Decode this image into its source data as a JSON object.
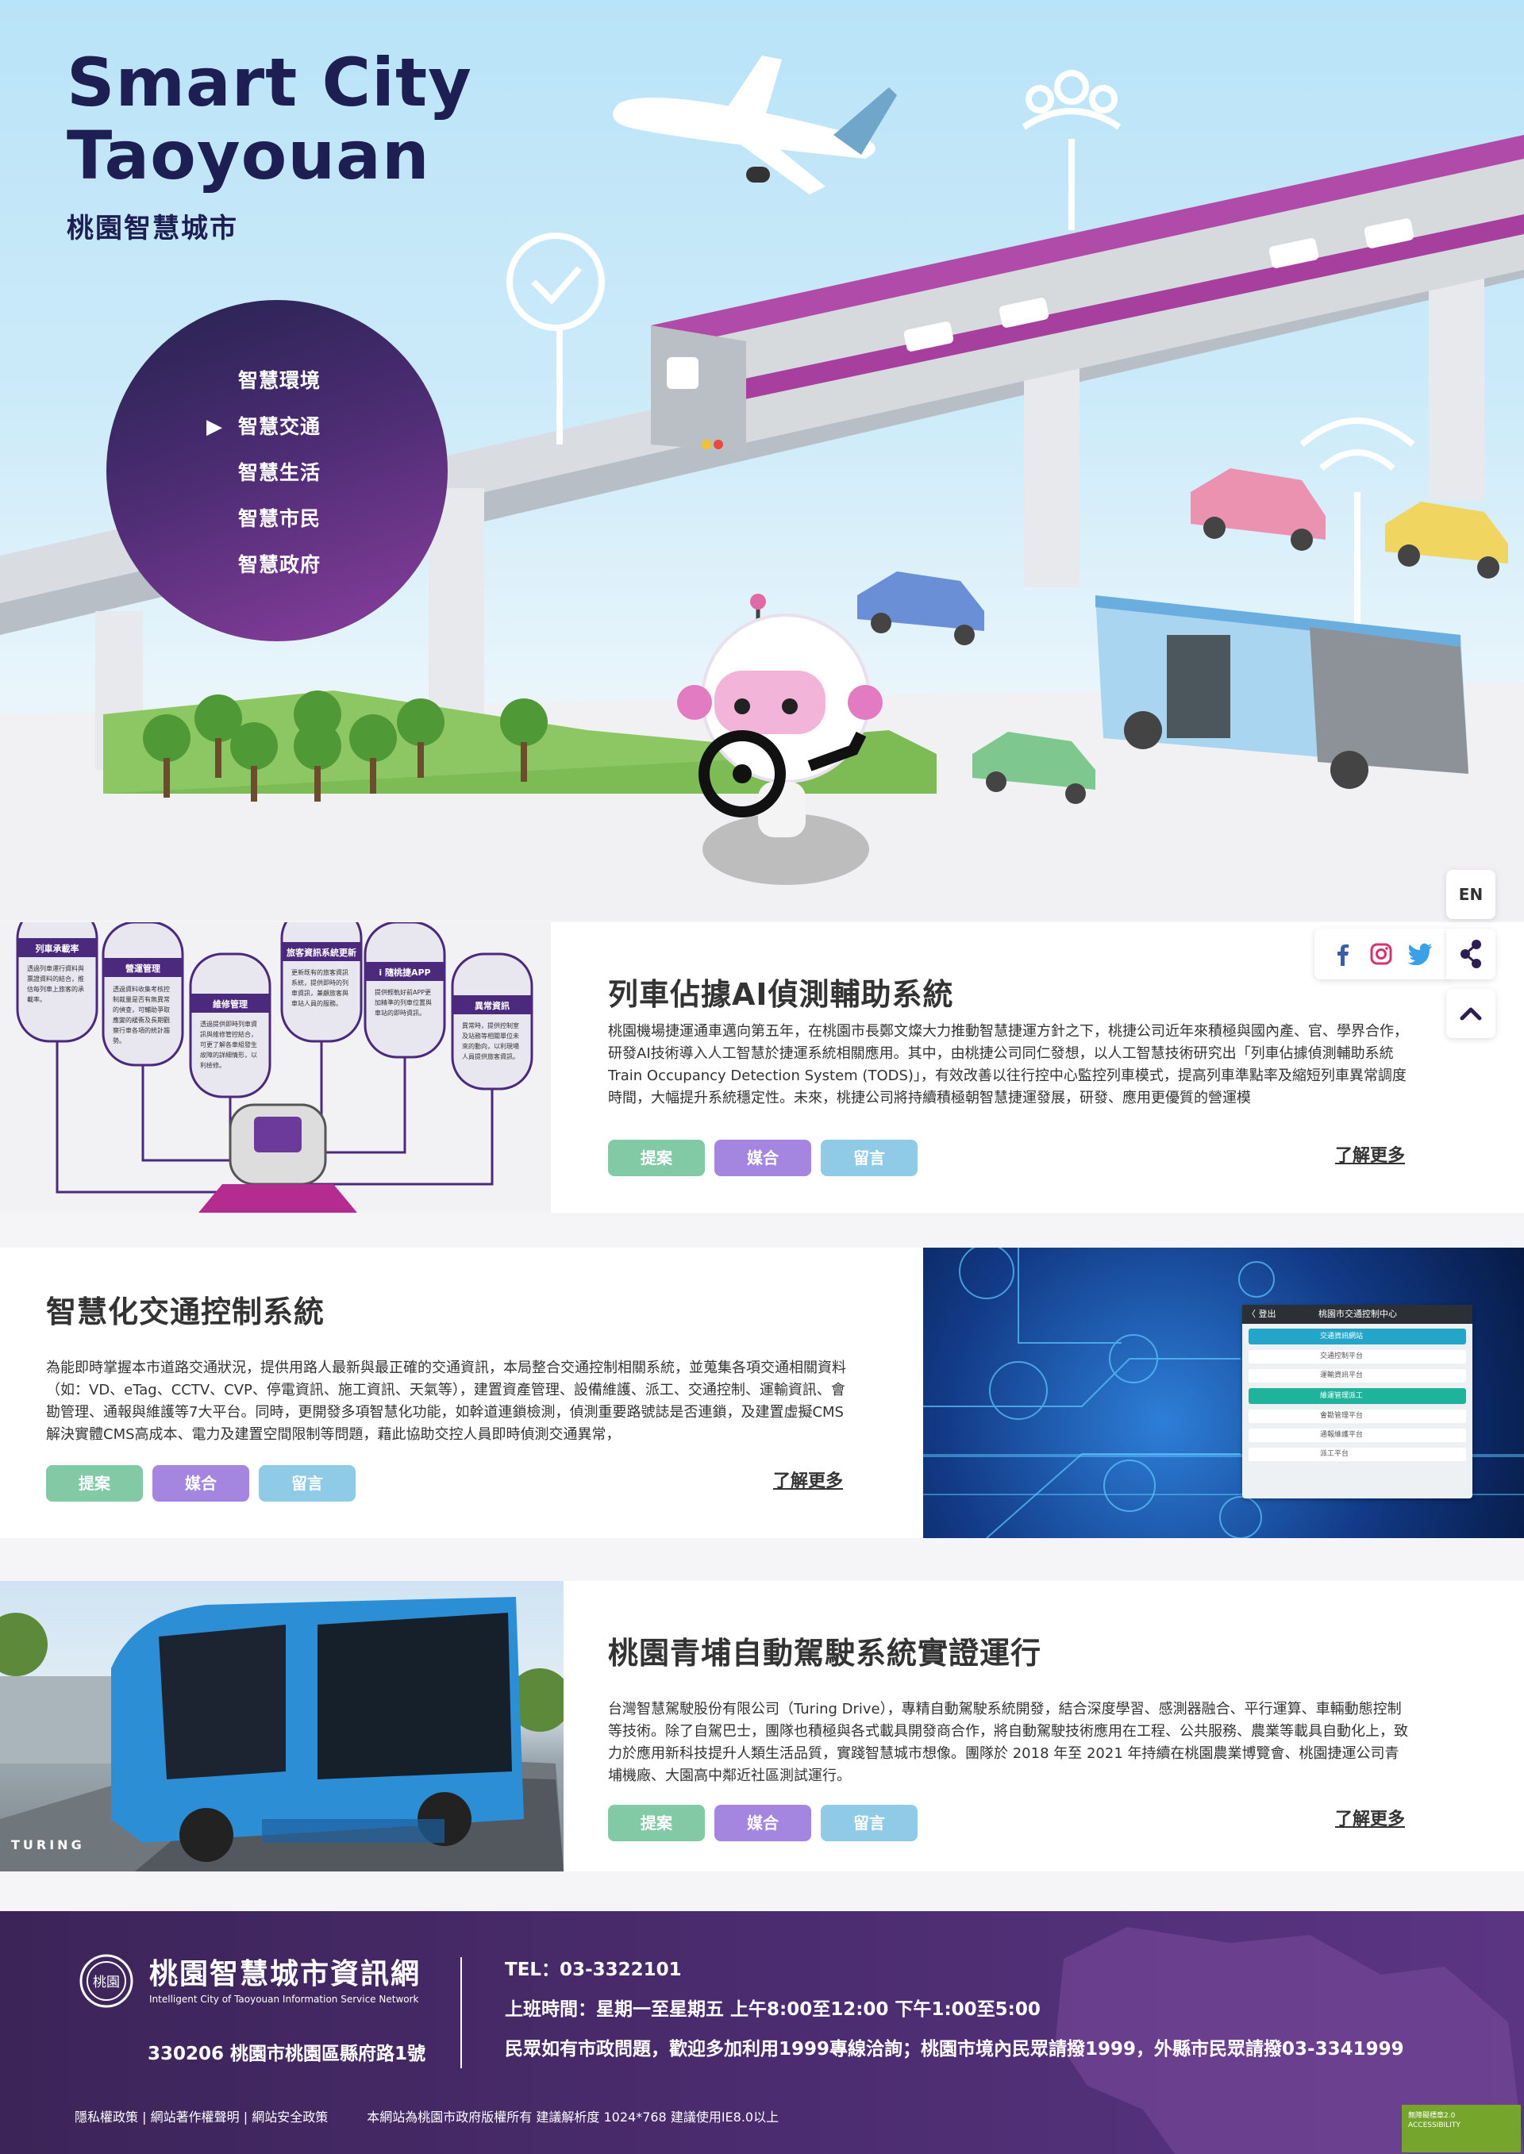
{
  "brand": {
    "title_line1": "Smart City",
    "title_line2": "Taoyouan",
    "subtitle": "桃園智慧城市"
  },
  "menu": {
    "items": [
      {
        "label": "智慧環境"
      },
      {
        "label": "智慧交通",
        "active": true
      },
      {
        "label": "智慧生活"
      },
      {
        "label": "智慧市民"
      },
      {
        "label": "智慧政府"
      }
    ]
  },
  "tools": {
    "lang_label": "EN",
    "social_icons": [
      "facebook-icon",
      "instagram-icon",
      "twitter-icon"
    ],
    "share_icon": "share-icon",
    "top_icon": "chevron-up-icon"
  },
  "buttons": {
    "propose": "提案",
    "match": "媒合",
    "comment": "留言",
    "more": "了解更多"
  },
  "colors": {
    "propose": "#82c9a5",
    "match": "#a486e0",
    "comment": "#8fcbe6",
    "purple": "#7d2f91",
    "navy": "#1d1e52"
  },
  "projects": [
    {
      "title": "列車佔據AI偵測輔助系統",
      "text": "桃園機場捷運通車邁向第五年，在桃園市長鄭文燦大力推動智慧捷運方針之下，桃捷公司近年來積極與國內產、官、學界合作，研發AI技術導入人工智慧於捷運系統相關應用。其中，由桃捷公司同仁發想，以人工智慧技術研究出「列車佔據偵測輔助系統Train Occupancy Detection System (TODS)」，有效改善以往行控中心監控列車模式，提高列車準點率及縮短列車異常調度時間，大幅提升系統穩定性。未來，桃捷公司將持續積極朝智慧捷運發展，研發、應用更優質的營運模",
      "image": {
        "boxes": [
          {
            "title": "列車承載率",
            "text": "透過列車運行資料與票證資料的結合，推估每列車上旅客的承載率。"
          },
          {
            "title": "營運管理",
            "text": "透過資料收集考核控制裁量是否有無異常的偵查，可輔助爭取應變的緩衝及長期觀察行車各項的統計趨勢。"
          },
          {
            "title": "維修管理",
            "text": "透過提供即時列車資訊與維修管控結合，可更了解各車組發生故障的詳細情形，以利檢修。"
          },
          {
            "title": "旅客資訊系統更新",
            "text": "更新既有的旅客資訊系統，提供即時的列車資訊，兼顧旅客與車站人員的服務。"
          },
          {
            "title": "i 隨桃捷APP",
            "text": "提供輕軌好前APP更加精準的列車位置與車站的即時資訊。"
          },
          {
            "title": "異常資訊",
            "text": "異常時，提供控制室及站務等相關單位未來的動向，以利現場人員提供旅客資訊。"
          }
        ]
      }
    },
    {
      "title": "智慧化交通控制系統",
      "text": "為能即時掌握本市道路交通狀況，提供用路人最新與最正確的交通資訊，本局整合交通控制相關系統，並蒐集各項交通相關資料（如：VD、eTag、CCTV、CVP、停電資訊、施工資訊、天氣等），建置資產管理、設備維護、派工、交通控制、運輸資訊、會勘管理、通報與維護等7大平台。同時，更開發多項智慧化功能，如幹道連鎖檢測，偵測重要路號誌是否連鎖，及建置虛擬CMS解決實體CMS高成本、電力及建置空間限制等問題，藉此協助交控人員即時偵測交通異常，",
      "image": {
        "panel_title": "桃園市交通控制中心",
        "panel_back": "〈 登出",
        "panel_items": [
          "交通資訊網站",
          "交通控制平台",
          "運輸資訊平台",
          "維運管理派工",
          "會勘管理平台",
          "通報維護平台",
          "派工平台"
        ]
      }
    },
    {
      "title": "桃園青埔自動駕駛系統實證運行",
      "text": "台灣智慧駕駛股份有限公司（Turing Drive），專精自動駕駛系統開發，結合深度學習、感測器融合、平行運算、車輛動態控制等技術。除了自駕巴士，團隊也積極與各式載具開發商合作，將自動駕駛技術應用在工程、公共服務、農業等載具自動化上，致力於應用新科技提升人類生活品質，實踐智慧城市想像。團隊於 2018 年至 2021 年持續在桃園農業博覽會、桃園捷運公司青埔機廠、大園高中鄰近社區測試運行。",
      "image": {
        "logo": "TURING"
      }
    }
  ],
  "footer": {
    "name": "桃園智慧城市資訊網",
    "name_en": "Intelligent City of Taoyouan Information Service Network",
    "emblem_text": "桃園",
    "address": "330206 桃園市桃園區縣府路1號",
    "tel": "TEL：03-3322101",
    "hours": "上班時間：星期一至星期五 上午8:00至12:00 下午1:00至5:00",
    "hotline": "民眾如有市政問題，歡迎多加利用1999專線洽詢；桃園市境內民眾請撥1999，外縣市民眾請撥03-3341999",
    "links": [
      "隱私權政策",
      "網站著作權聲明",
      "網站安全政策"
    ],
    "copyright": "本網站為桃園市政府版權所有 建議解析度 1024*768 建議使用IE8.0以上",
    "badge_line1": "無障礙標章2.0",
    "badge_line2": "ACCESSIBILITY"
  }
}
